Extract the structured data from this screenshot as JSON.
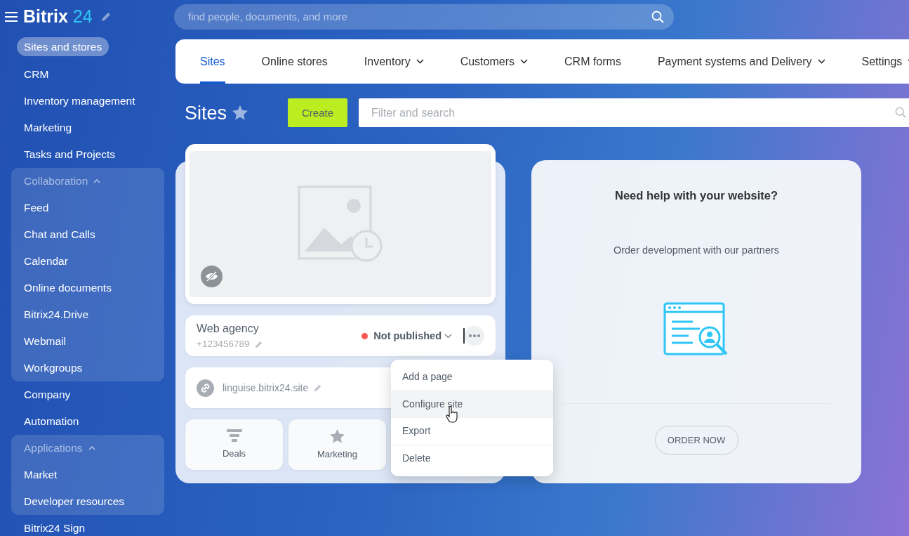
{
  "header": {
    "logo_text": "Bitrix",
    "logo_number": "24",
    "search": {
      "placeholder": "find people, documents, and more"
    }
  },
  "sidebar": {
    "items": [
      {
        "kind": "item",
        "label": "Sites and stores",
        "selected": true
      },
      {
        "kind": "item",
        "label": "CRM",
        "selected": false
      },
      {
        "kind": "item",
        "label": "Inventory management",
        "selected": false
      },
      {
        "kind": "item",
        "label": "Marketing",
        "selected": false
      },
      {
        "kind": "item",
        "label": "Tasks and Projects",
        "selected": false
      },
      {
        "kind": "group",
        "label": "Collaboration",
        "expanded": true,
        "selected": false,
        "children": [
          {
            "kind": "item",
            "label": "Feed",
            "selected": false
          },
          {
            "kind": "item",
            "label": "Chat and Calls",
            "selected": false
          },
          {
            "kind": "item",
            "label": "Calendar",
            "selected": false
          },
          {
            "kind": "item",
            "label": "Online documents",
            "selected": false
          },
          {
            "kind": "item",
            "label": "Bitrix24.Drive",
            "selected": false
          },
          {
            "kind": "item",
            "label": "Webmail",
            "selected": false
          },
          {
            "kind": "item",
            "label": "Workgroups",
            "selected": false
          }
        ]
      },
      {
        "kind": "item",
        "label": "Company",
        "selected": false
      },
      {
        "kind": "item",
        "label": "Automation",
        "selected": false
      },
      {
        "kind": "group",
        "label": "Applications",
        "expanded": true,
        "selected": false,
        "children": [
          {
            "kind": "item",
            "label": "Market",
            "selected": false
          },
          {
            "kind": "item",
            "label": "Developer resources",
            "selected": false
          }
        ]
      },
      {
        "kind": "item",
        "label": "Bitrix24 Sign",
        "selected": false
      }
    ]
  },
  "tabs": [
    {
      "label": "Sites",
      "selected": true,
      "dropdown": false
    },
    {
      "label": "Online stores",
      "selected": false,
      "dropdown": false
    },
    {
      "label": "Inventory",
      "selected": false,
      "dropdown": true
    },
    {
      "label": "Customers",
      "selected": false,
      "dropdown": true
    },
    {
      "label": "CRM forms",
      "selected": false,
      "dropdown": false
    },
    {
      "label": "Payment systems and Delivery",
      "selected": false,
      "dropdown": true
    },
    {
      "label": "Settings",
      "selected": false,
      "dropdown": true
    }
  ],
  "page": {
    "title": "Sites",
    "create_button": "Create",
    "filter": {
      "placeholder": "Filter and search"
    }
  },
  "site": {
    "name": "Web agency",
    "phone": "+123456789",
    "published": false,
    "status": "Not published",
    "domain": "linguise.bitrix24.site",
    "tiles": [
      {
        "kind": "funnel",
        "label": "Deals"
      },
      {
        "kind": "star",
        "label": "Marketing"
      }
    ]
  },
  "menu": [
    {
      "label": "Add a page",
      "hovered": false
    },
    {
      "label": "Configure site",
      "hovered": true
    },
    {
      "label": "Export",
      "hovered": false
    },
    {
      "label": "Delete",
      "hovered": false
    }
  ],
  "help": {
    "title": "Need help with your website?",
    "subtitle": "Order development with our partners",
    "button": "ORDER NOW"
  }
}
